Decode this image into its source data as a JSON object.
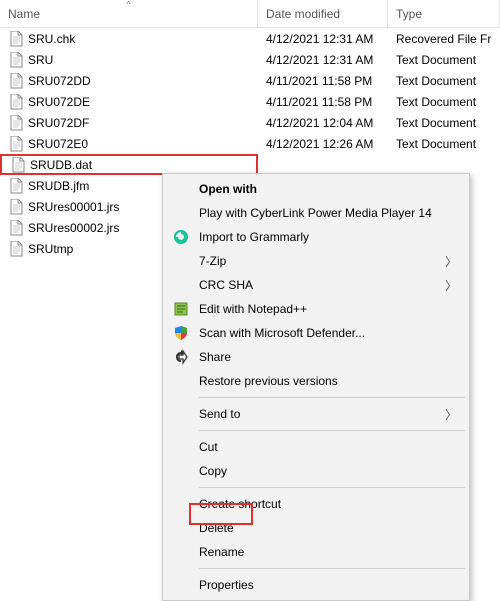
{
  "columns": {
    "name": "Name",
    "date": "Date modified",
    "type": "Type"
  },
  "files": [
    {
      "name": "SRU.chk",
      "date": "4/12/2021 12:31 AM",
      "type": "Recovered File Fr"
    },
    {
      "name": "SRU",
      "date": "4/12/2021 12:31 AM",
      "type": "Text Document"
    },
    {
      "name": "SRU072DD",
      "date": "4/11/2021 11:58 PM",
      "type": "Text Document"
    },
    {
      "name": "SRU072DE",
      "date": "4/11/2021 11:58 PM",
      "type": "Text Document"
    },
    {
      "name": "SRU072DF",
      "date": "4/12/2021 12:04 AM",
      "type": "Text Document"
    },
    {
      "name": "SRU072E0",
      "date": "4/12/2021 12:26 AM",
      "type": "Text Document"
    },
    {
      "name": "SRUDB.dat",
      "date": "",
      "type": ""
    },
    {
      "name": "SRUDB.jfm",
      "date": "",
      "type": ""
    },
    {
      "name": "SRUres00001.jrs",
      "date": "",
      "type": ""
    },
    {
      "name": "SRUres00002.jrs",
      "date": "",
      "type": ""
    },
    {
      "name": "SRUtmp",
      "date": "",
      "type": ""
    }
  ],
  "selected_index": 6,
  "context_menu": {
    "open_with": "Open with",
    "cyberlink": "Play with CyberLink Power Media Player 14",
    "grammarly": "Import to Grammarly",
    "sevenzip": "7-Zip",
    "crcsha": "CRC SHA",
    "notepadpp": "Edit with Notepad++",
    "defender": "Scan with Microsoft Defender...",
    "share": "Share",
    "restore": "Restore previous versions",
    "sendto": "Send to",
    "cut": "Cut",
    "copy": "Copy",
    "shortcut": "Create shortcut",
    "delete": "Delete",
    "rename": "Rename",
    "properties": "Properties"
  }
}
